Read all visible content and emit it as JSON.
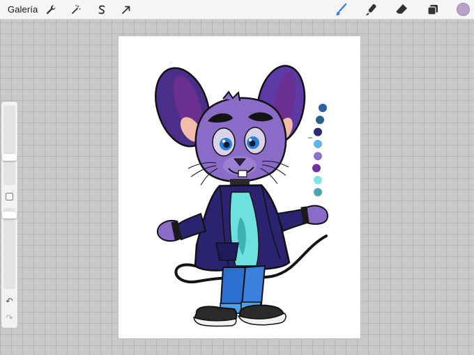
{
  "toolbar": {
    "gallery_label": "Galería",
    "left_tools": [
      "wrench-icon",
      "magic-wand-icon",
      "selection-s-icon",
      "transform-arrow-icon"
    ],
    "right_tools": [
      "brush-icon",
      "smudge-icon",
      "eraser-icon",
      "layers-icon"
    ],
    "active_tool": "brush-icon",
    "accent_color": "#2f7cf6",
    "current_color": "#b9a1c9"
  },
  "sidebar": {
    "brush_size_level": 0.28,
    "opacity_level": 0.1,
    "undo_glyph": "↶",
    "redo_glyph": "↷"
  },
  "canvas": {
    "palette_colors": [
      "#2c5fa8",
      "#27628f",
      "#2a2a6e",
      "#5fb5e6",
      "#8d74c9",
      "#70319a",
      "#7fe3e6",
      "#49a8ae"
    ],
    "character_colors": {
      "fur": "#8a6cc8",
      "fur_shadow": "#6d53b0",
      "ear_inner": "#6a2f91",
      "ear_blush": "#f2bca8",
      "jacket": "#2b2370",
      "shirt": "#6ee0e0",
      "jeans": "#2b6fcf",
      "shoe": "#2a2a2a",
      "sole": "#f2f2f4"
    }
  }
}
